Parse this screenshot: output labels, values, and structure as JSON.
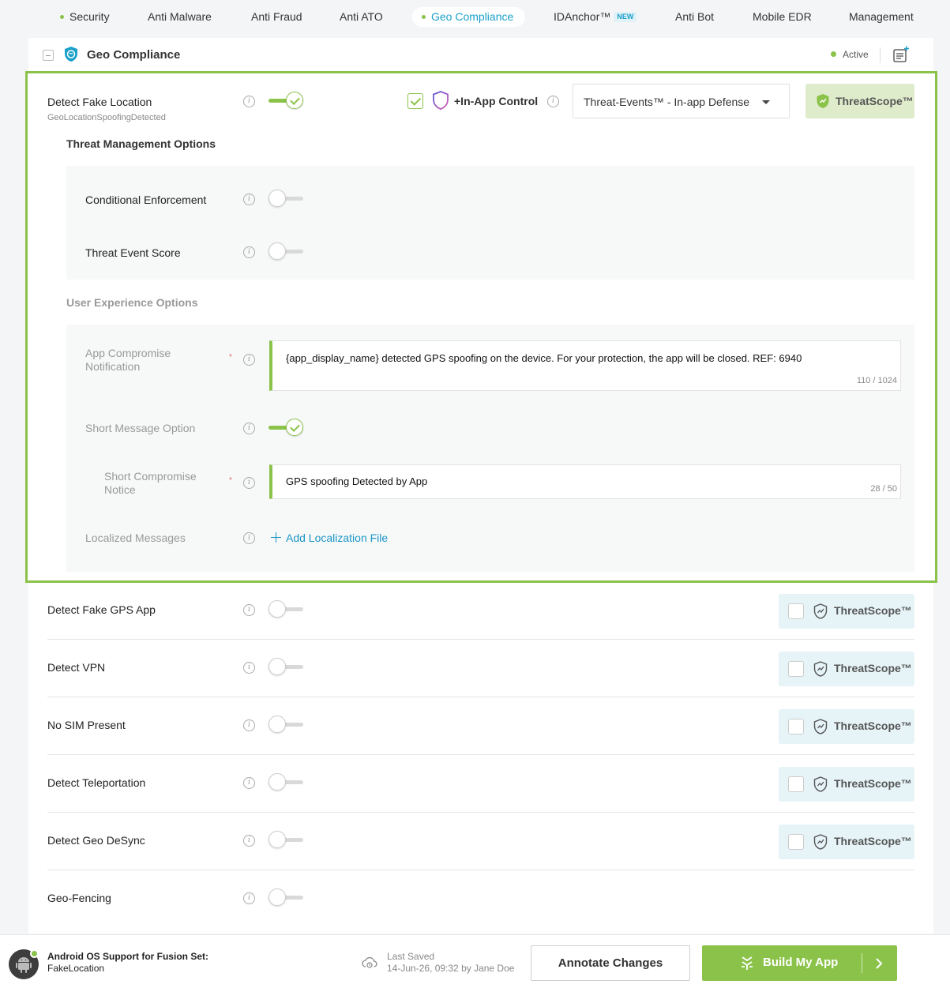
{
  "nav": {
    "tabs": [
      {
        "label": "Security",
        "dot": true
      },
      {
        "label": "Anti Malware"
      },
      {
        "label": "Anti Fraud"
      },
      {
        "label": "Anti ATO"
      },
      {
        "label": "Geo Compliance",
        "dot": true,
        "active": true
      },
      {
        "label": "IDAnchor™",
        "badge": "NEW"
      },
      {
        "label": "Anti Bot"
      },
      {
        "label": "Mobile EDR"
      },
      {
        "label": "Management"
      }
    ]
  },
  "card": {
    "title": "Geo Compliance",
    "status": "Active",
    "status_color": "#8bc34a"
  },
  "expanded": {
    "label": "Detect Fake Location",
    "sublabel": "GeoLocationSpoofingDetected",
    "enabled": true,
    "inapp_control": {
      "label": "+In-App Control",
      "checked": true
    },
    "dropdown_value": "Threat-Events™ - In-app Defense",
    "threatscope_label": "ThreatScope™",
    "threat_mgmt": {
      "title": "Threat Management Options",
      "items": [
        {
          "label": "Conditional Enforcement",
          "enabled": false
        },
        {
          "label": "Threat Event Score",
          "enabled": false
        }
      ]
    },
    "ux": {
      "title": "User Experience Options",
      "app_notification": {
        "label_line1": "App Compromise",
        "label_line2": "Notification",
        "value": "{app_display_name} detected GPS spoofing on the device. For your protection, the app will be closed. REF: 6940",
        "counter": "110 / 1024"
      },
      "short_message_option": {
        "label": "Short Message Option",
        "enabled": true
      },
      "short_notice": {
        "label_line1": "Short Compromise",
        "label_line2": "Notice",
        "value": "GPS spoofing Detected by App",
        "counter": "28 / 50"
      },
      "localized": {
        "label": "Localized Messages",
        "action": "Add Localization File"
      }
    }
  },
  "features": [
    {
      "label": "Detect Fake GPS App",
      "enabled": false,
      "threatscope": "ThreatScope™"
    },
    {
      "label": "Detect VPN",
      "enabled": false,
      "threatscope": "ThreatScope™"
    },
    {
      "label": "No SIM Present",
      "enabled": false,
      "threatscope": "ThreatScope™"
    },
    {
      "label": "Detect Teleportation",
      "enabled": false,
      "threatscope": "ThreatScope™"
    },
    {
      "label": "Detect Geo DeSync",
      "enabled": false,
      "threatscope": "ThreatScope™"
    },
    {
      "label": "Geo-Fencing",
      "enabled": false
    }
  ],
  "footer": {
    "os_line1": "Android OS Support for Fusion Set:",
    "os_line2": "FakeLocation",
    "saved_line1": "Last Saved",
    "saved_line2": "14-Jun-26, 09:32 by Jane Doe",
    "annotate_label": "Annotate Changes",
    "build_label": "Build My App"
  },
  "colors": {
    "accent_green": "#8bc34a",
    "accent_blue": "#1aa0c9"
  }
}
